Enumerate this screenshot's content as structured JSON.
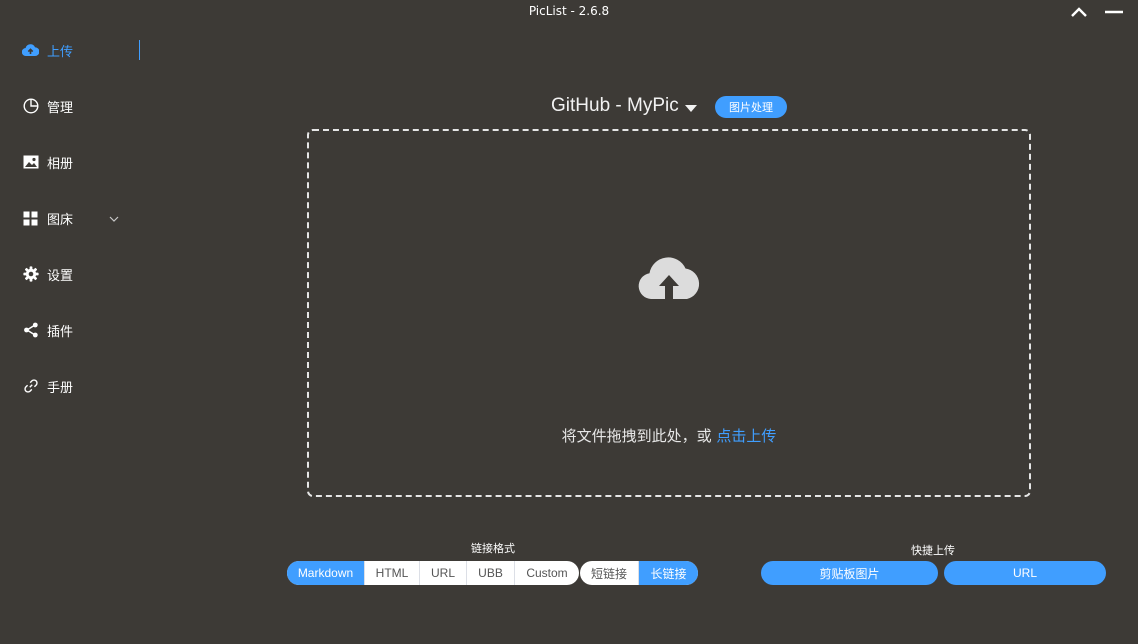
{
  "window": {
    "title": "PicList - 2.6.8"
  },
  "sidebar": {
    "items": [
      {
        "label": "上传",
        "icon": "cloud-upload-icon",
        "active": true
      },
      {
        "label": "管理",
        "icon": "pie-chart-icon"
      },
      {
        "label": "相册",
        "icon": "picture-icon"
      },
      {
        "label": "图床",
        "icon": "grid-icon",
        "has_submenu": true
      },
      {
        "label": "设置",
        "icon": "gear-icon"
      },
      {
        "label": "插件",
        "icon": "share-icon"
      },
      {
        "label": "手册",
        "icon": "link-icon"
      }
    ]
  },
  "main": {
    "picbed_title": "GitHub - MyPic",
    "image_process_label": "图片处理",
    "dropzone": {
      "text": "将文件拖拽到此处，或 ",
      "link": "点击上传"
    }
  },
  "link_format": {
    "label": "链接格式",
    "options": [
      "Markdown",
      "HTML",
      "URL",
      "UBB",
      "Custom"
    ],
    "selected": "Markdown",
    "length_options": [
      "短链接",
      "长链接"
    ],
    "length_selected": "长链接"
  },
  "quick_upload": {
    "label": "快捷上传",
    "clipboard_label": "剪贴板图片",
    "url_label": "URL"
  },
  "colors": {
    "background": "#3d3a36",
    "accent": "#409eff",
    "text": "#ffffff"
  }
}
